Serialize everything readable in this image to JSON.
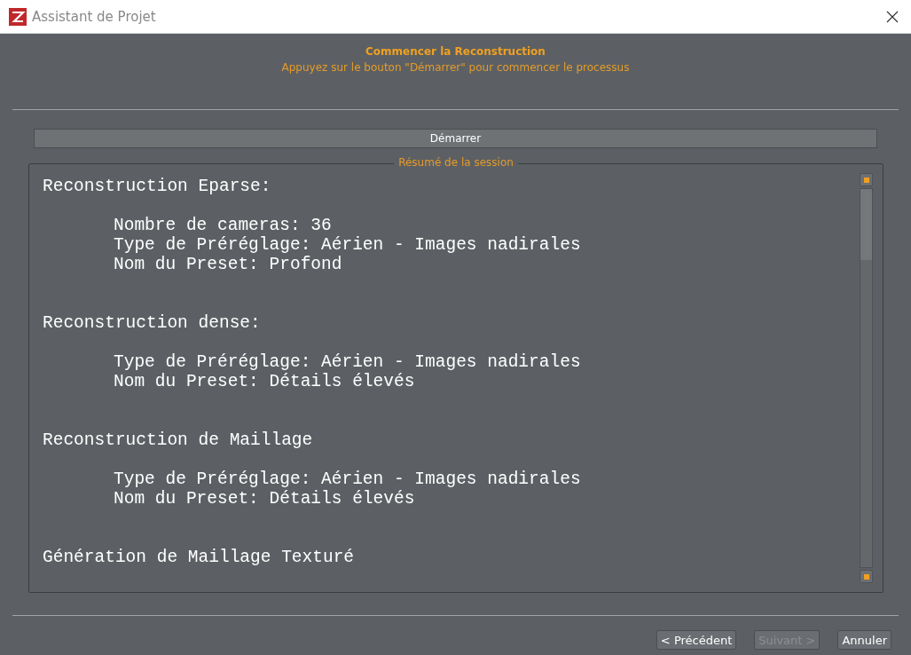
{
  "window": {
    "title": "Assistant de Projet"
  },
  "header": {
    "title": "Commencer la Reconstruction",
    "subtitle": "Appuyez sur le bouton \"Démarrer\" pour commencer le processus"
  },
  "start_button": {
    "label": "Démarrer",
    "disabled": false
  },
  "summary": {
    "title": "Résumé de la session",
    "sections": [
      {
        "heading": "Reconstruction Eparse:",
        "lines": [
          "Nombre de cameras: 36",
          "Type de Préréglage: Aérien - Images nadirales",
          "Nom du Preset: Profond"
        ]
      },
      {
        "heading": "Reconstruction dense:",
        "lines": [
          "Type de Préréglage: Aérien - Images nadirales",
          "Nom du Preset: Détails élevés"
        ]
      },
      {
        "heading": "Reconstruction de Maillage",
        "lines": [
          "Type de Préréglage: Aérien - Images nadirales",
          "Nom du Preset: Détails élevés"
        ]
      },
      {
        "heading": "Génération de Maillage Texturé"
      }
    ]
  },
  "buttons": [
    {
      "label": "< Précédent",
      "disabled": false
    },
    {
      "label": "Suivant >",
      "disabled": true
    },
    {
      "label": "Annuler",
      "disabled": false
    }
  ]
}
